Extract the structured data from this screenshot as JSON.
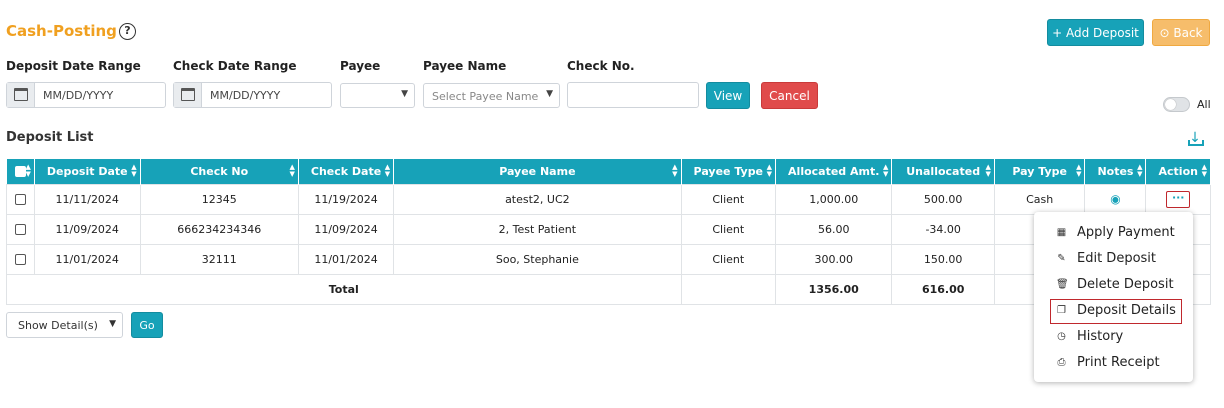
{
  "header": {
    "title": "Cash-Posting",
    "help_glyph": "?",
    "add_deposit_label": "+ Add Deposit",
    "back_label": "⊙ Back"
  },
  "filters": {
    "deposit_date_label": "Deposit Date Range",
    "check_date_label": "Check Date Range",
    "payee_label": "Payee",
    "payee_name_label": "Payee Name",
    "check_no_label": "Check No.",
    "deposit_date_placeholder": "MM/DD/YYYY",
    "check_date_placeholder": "MM/DD/YYYY",
    "payee_value": "",
    "payee_name_placeholder": "Select Payee Name",
    "check_no_value": "",
    "view_label": "View",
    "cancel_label": "Cancel",
    "all_toggle_label": "All"
  },
  "deposit_list": {
    "title": "Deposit List",
    "columns": [
      "Deposit Date",
      "Check No",
      "Check Date",
      "Payee Name",
      "Payee Type",
      "Allocated Amt.",
      "Unallocated",
      "Pay Type",
      "Notes",
      "Action"
    ],
    "rows": [
      {
        "deposit_date": "11/11/2024",
        "check_no": "12345",
        "check_date": "11/19/2024",
        "payee_name": "atest2, UC2",
        "payee_type": "Client",
        "allocated": "1,000.00",
        "unallocated": "500.00",
        "pay_type": "Cash",
        "has_note": true
      },
      {
        "deposit_date": "11/09/2024",
        "check_no": "666234234346",
        "check_date": "11/09/2024",
        "payee_name": "2, Test Patient",
        "payee_type": "Client",
        "allocated": "56.00",
        "unallocated": "-34.00",
        "pay_type": "",
        "has_note": false
      },
      {
        "deposit_date": "11/01/2024",
        "check_no": "32111",
        "check_date": "11/01/2024",
        "payee_name": "Soo, Stephanie",
        "payee_type": "Client",
        "allocated": "300.00",
        "unallocated": "150.00",
        "pay_type": "",
        "has_note": false
      }
    ],
    "total_label": "Total",
    "total_allocated": "1356.00",
    "total_unallocated": "616.00",
    "action_glyph": "···"
  },
  "action_menu": {
    "items": [
      {
        "label": "Apply Payment",
        "icon": "grid-icon",
        "glyph": "▦"
      },
      {
        "label": "Edit Deposit",
        "icon": "pencil-icon",
        "glyph": "✎"
      },
      {
        "label": "Delete Deposit",
        "icon": "trash-icon",
        "glyph": "🗑"
      },
      {
        "label": "Deposit Details",
        "icon": "copy-icon",
        "glyph": "❐"
      },
      {
        "label": "History",
        "icon": "clock-icon",
        "glyph": "◷"
      },
      {
        "label": "Print Receipt",
        "icon": "printer-icon",
        "glyph": "⎙"
      }
    ],
    "highlighted": "Deposit Details"
  },
  "footer": {
    "show_details_value": "Show Detail(s)",
    "go_label": "Go"
  },
  "colors": {
    "accent": "#17a2b8",
    "title": "#f0a020",
    "danger": "#e04b4b",
    "back": "#f6bd6b"
  }
}
